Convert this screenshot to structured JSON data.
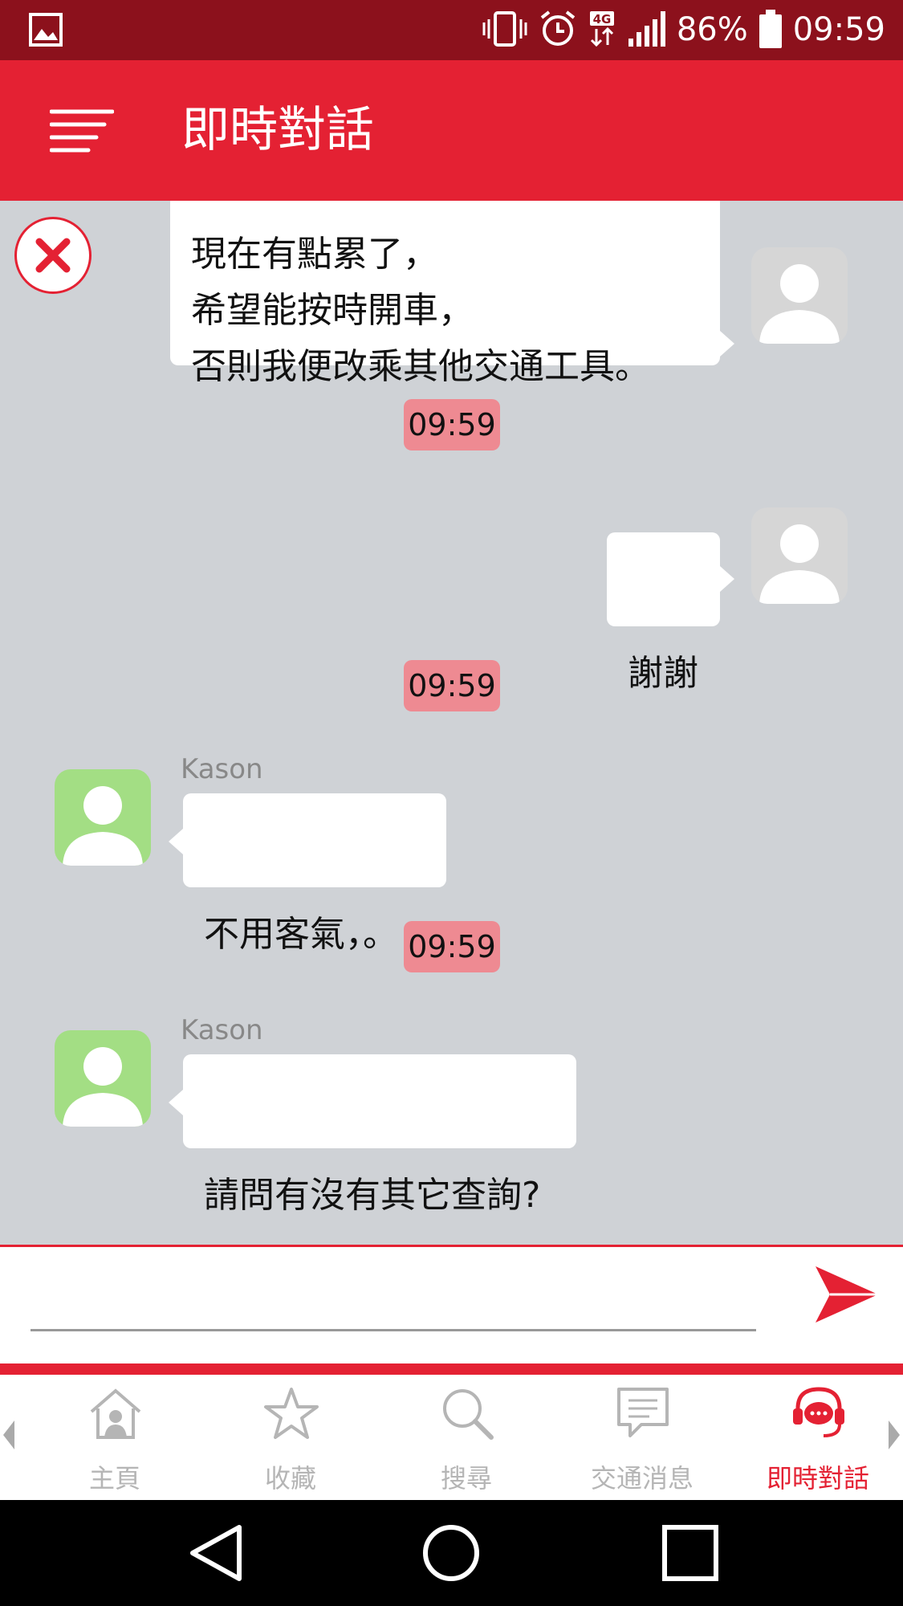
{
  "status_bar": {
    "battery_percent": "86%",
    "time": "09:59",
    "network": "4G"
  },
  "app_bar": {
    "title": "即時對話"
  },
  "chat": {
    "messages": [
      {
        "side": "right",
        "text": "現在有點累了，\n希望能按時開車，\n否則我便改乘其他交通工具。"
      },
      {
        "type": "timestamp",
        "text": "09:59"
      },
      {
        "side": "right",
        "text": "謝謝"
      },
      {
        "type": "timestamp",
        "text": "09:59"
      },
      {
        "side": "left",
        "sender": "Kason",
        "text": "不用客氣，。"
      },
      {
        "type": "timestamp",
        "text": "09:59"
      },
      {
        "side": "left",
        "sender": "Kason",
        "text": "請問有沒有其它查詢?"
      }
    ]
  },
  "input": {
    "value": "",
    "placeholder": ""
  },
  "bottom_nav": {
    "items": [
      {
        "label": "主頁",
        "icon": "home-icon"
      },
      {
        "label": "收藏",
        "icon": "star-icon"
      },
      {
        "label": "搜尋",
        "icon": "search-icon"
      },
      {
        "label": "交通消息",
        "icon": "message-icon"
      },
      {
        "label": "即時對話",
        "icon": "live-chat-icon",
        "active": true
      }
    ]
  },
  "colors": {
    "primary": "#e42133",
    "status_bar": "#8c111c",
    "chat_background": "#cfd2d6",
    "timestamp_bg": "#ee8a92",
    "agent_avatar": "#a3de84"
  }
}
